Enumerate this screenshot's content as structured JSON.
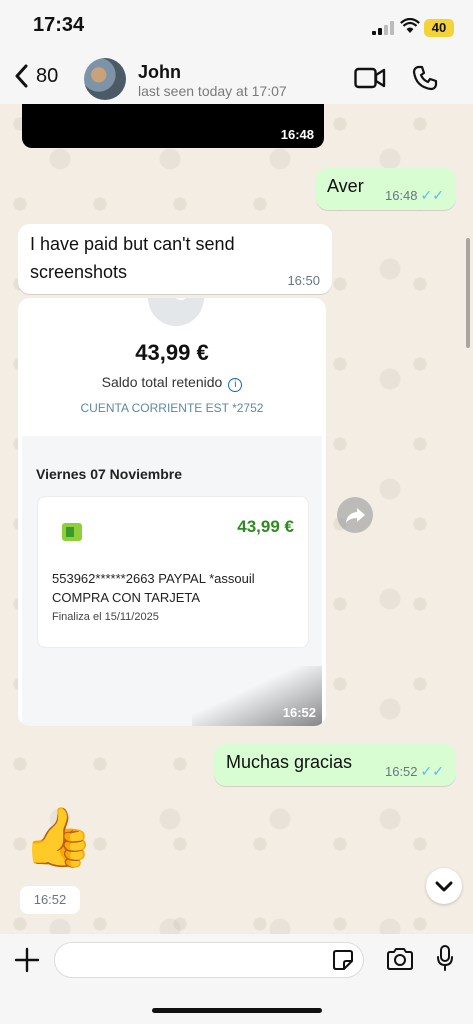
{
  "status_bar": {
    "time": "17:34",
    "battery": "40"
  },
  "header": {
    "back_count": "80",
    "contact_name": "John",
    "last_seen": "last seen today at 17:07"
  },
  "messages": {
    "video_time": "16:48",
    "aver": {
      "text": "Aver",
      "time": "16:48"
    },
    "paid": {
      "text": "I have paid but can't send screenshots",
      "time": "16:50"
    },
    "image": {
      "amount": "43,99 €",
      "saldo_label": "Saldo total retenido",
      "cuenta": "CUENTA CORRIENTE EST *2752",
      "date_label": "Viernes 07 Noviembre",
      "tx_amount": "43,99 €",
      "tx_line1": "553962******2663 PAYPAL *assouil",
      "tx_line2": "COMPRA CON TARJETA",
      "tx_final": "Finaliza el 15/11/2025",
      "time": "16:52"
    },
    "gracias": {
      "text": "Muchas gracias",
      "time": "16:52"
    },
    "emoji": {
      "char": "👍",
      "time": "16:52"
    }
  },
  "input": {
    "placeholder": ""
  },
  "colors": {
    "outgoing_bubble": "#d9fdd3",
    "incoming_bubble": "#ffffff",
    "read_ticks": "#53bdeb",
    "amount_green": "#2e8b1f"
  }
}
